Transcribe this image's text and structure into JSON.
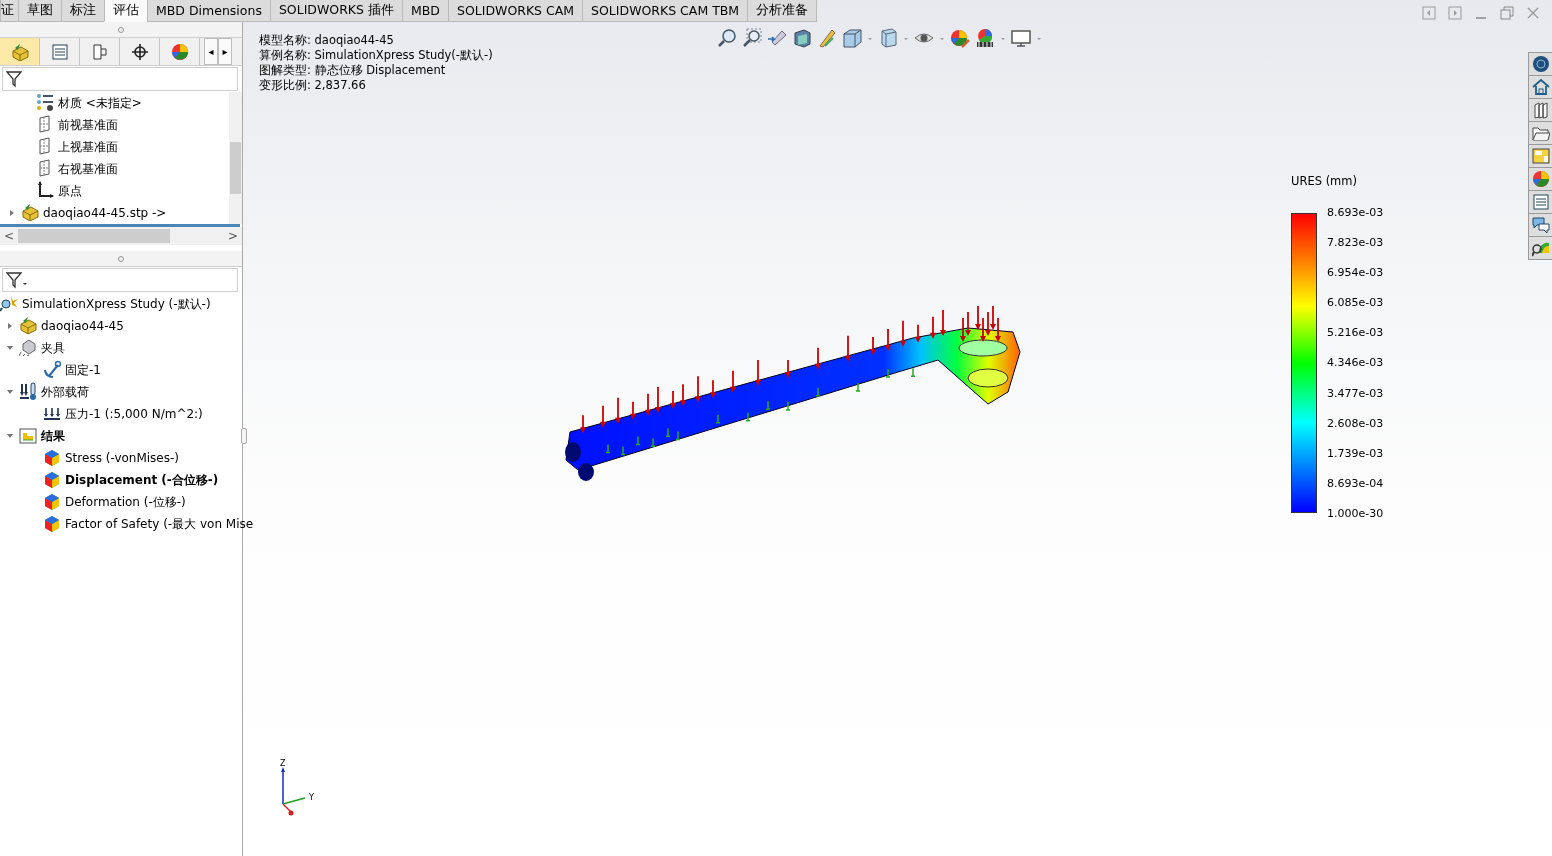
{
  "tabs": [
    {
      "label": "证",
      "selected": false
    },
    {
      "label": "草图",
      "selected": false
    },
    {
      "label": "标注",
      "selected": false
    },
    {
      "label": "评估",
      "selected": true
    },
    {
      "label": "MBD Dimensions",
      "selected": false
    },
    {
      "label": "SOLIDWORKS 插件",
      "selected": false
    },
    {
      "label": "MBD",
      "selected": false
    },
    {
      "label": "SOLIDWORKS CAM",
      "selected": false
    },
    {
      "label": "SOLIDWORKS CAM TBM",
      "selected": false
    },
    {
      "label": "分析准备",
      "selected": false
    }
  ],
  "panel_tabs": [
    {
      "kind": "part",
      "selected": true
    },
    {
      "kind": "properties",
      "selected": false
    },
    {
      "kind": "config",
      "selected": false
    },
    {
      "kind": "target",
      "selected": false
    },
    {
      "kind": "appearance",
      "selected": false
    }
  ],
  "panel_tab_scroll": [
    "◂",
    "▸"
  ],
  "feature_tree": [
    {
      "kind": "material",
      "label": "材质 <未指定>"
    },
    {
      "kind": "plane",
      "label": "前视基准面"
    },
    {
      "kind": "plane",
      "label": "上视基准面"
    },
    {
      "kind": "plane",
      "label": "右视基准面"
    },
    {
      "kind": "origin",
      "label": "原点"
    },
    {
      "kind": "part",
      "label": "daoqiao44-45.stp ->",
      "expanded": false
    }
  ],
  "horizontal_scroll": [
    "<",
    ">"
  ],
  "study_tree": {
    "kind": "study",
    "label": "SimulationXpress Study (-默认-)",
    "children": [
      {
        "kind": "part",
        "label": "daoqiao44-45",
        "expanded": false
      },
      {
        "kind": "fixture",
        "label": "夹具",
        "expanded": true,
        "children": [
          {
            "kind": "anchor",
            "label": "固定-1"
          }
        ]
      },
      {
        "kind": "load",
        "label": "外部载荷",
        "expanded": true,
        "children": [
          {
            "kind": "pressure",
            "label": "压力-1 (:5,000 N/m^2:)"
          }
        ]
      },
      {
        "kind": "results",
        "label": "结果",
        "expanded": true,
        "bold": true,
        "children": [
          {
            "kind": "plot",
            "label": "Stress (-vonMises-)",
            "bold": false
          },
          {
            "kind": "plot",
            "label": "Displacement (-合位移-)",
            "bold": true
          },
          {
            "kind": "plot",
            "label": "Deformation (-位移-)",
            "bold": false
          },
          {
            "kind": "plot",
            "label": "Factor of Safety (-最大 von Mise",
            "bold": false
          }
        ]
      }
    ]
  },
  "info": [
    "模型名称: daoqiao44-45",
    "算例名称: SimulationXpress Study(-默认-)",
    "图解类型: 静态位移 Displacement",
    "变形比例: 2,837.66"
  ],
  "legend": {
    "title": "URES (mm)",
    "ticks": [
      "8.693e-03",
      "7.823e-03",
      "6.954e-03",
      "6.085e-03",
      "5.216e-03",
      "4.346e-03",
      "3.477e-03",
      "2.608e-03",
      "1.739e-03",
      "8.693e-04",
      "1.000e-30"
    ]
  },
  "triad": {
    "z": "Z",
    "y": "Y"
  }
}
